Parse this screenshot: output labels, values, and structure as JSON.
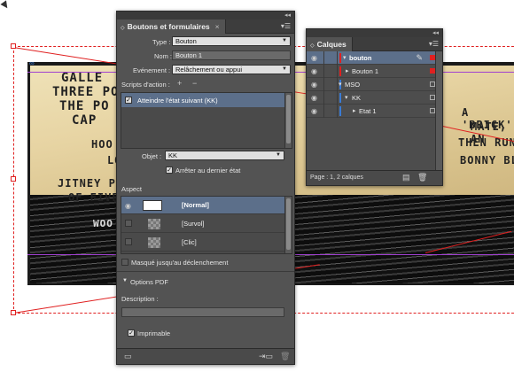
{
  "comic": {
    "lines": [
      "GALLE",
      "THREE PO",
      "THE PO",
      "CAP",
      "HOO",
      "LO",
      "JITNEY P",
      "OF FIVE",
      "WOO",
      "A 'BRICK'",
      "MATE, AN",
      "THEN RUN",
      "BONNY BL"
    ]
  },
  "buttons_panel": {
    "title": "Boutons et formulaires",
    "type_label": "Type :",
    "type_value": "Bouton",
    "name_label": "Nom :",
    "name_value": "Bouton 1",
    "event_label": "Evénement :",
    "event_value": "Relâchement ou appui",
    "scripts_label": "Scripts d'action :",
    "add_action": "+",
    "remove_action": "−",
    "action_item": "Atteindre l'état suivant (KK)",
    "object_label": "Objet :",
    "object_value": "KK",
    "stop_at_last_label": "Arrêter au dernier état",
    "aspect_label": "Aspect",
    "states": [
      "[Normal]",
      "[Survol]",
      "[Clic]"
    ],
    "hidden_until_trigger_label": "Masqué jusqu'au déclenchement",
    "pdf_options_label": "Options PDF",
    "description_label": "Description :",
    "printable_label": "Imprimable"
  },
  "layers_panel": {
    "title": "Calques",
    "layers": [
      {
        "name": "bouton",
        "color": "#e02020",
        "level": 0,
        "expanded": true,
        "selected": true
      },
      {
        "name": "Bouton 1",
        "color": "#e02020",
        "level": 1,
        "expanded": false,
        "selected": false
      },
      {
        "name": "MSO",
        "color": "#3a7bd5",
        "level": 0,
        "expanded": true,
        "selected": false
      },
      {
        "name": "KK",
        "color": "#3a7bd5",
        "level": 1,
        "expanded": true,
        "selected": false
      },
      {
        "name": "Etat 1",
        "color": "#3a7bd5",
        "level": 2,
        "expanded": false,
        "selected": false
      }
    ],
    "footer_text": "Page : 1, 2 calques"
  },
  "colors": {
    "panel_bg": "#535353",
    "selection_blue": "#5c6f8a",
    "frame_red": "#e02020",
    "layer_red": "#e02020",
    "layer_blue": "#3a7bd5"
  }
}
